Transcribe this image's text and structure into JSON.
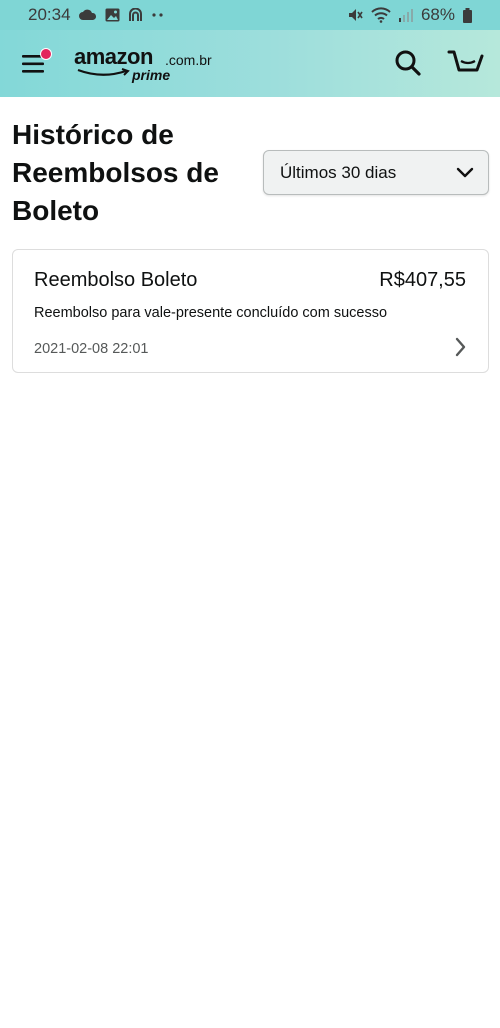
{
  "status_bar": {
    "time": "20:34",
    "battery": "68%"
  },
  "header": {
    "logo_word": "amazon",
    "logo_tld": ".com.br",
    "logo_sub": "prime",
    "icons": [
      "menu-icon",
      "search-icon",
      "cart-icon"
    ],
    "menu_notification_color": "#e3245c",
    "accent_color": "#83d8d8"
  },
  "page": {
    "title": "Histórico de Reembolsos de Boleto",
    "filter": {
      "selected": "Últimos 30 dias"
    }
  },
  "refunds": [
    {
      "title": "Reembolso Boleto",
      "amount": "R$407,55",
      "description": "Reembolso para vale-presente concluído com sucesso",
      "date": "2021-02-08 22:01"
    }
  ]
}
